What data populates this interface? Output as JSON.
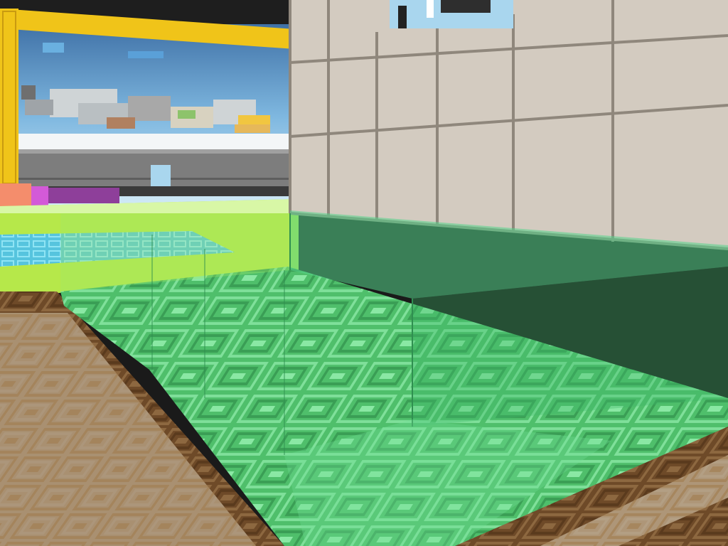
{
  "game": {
    "view": "first-person",
    "hud": "none",
    "colors": {
      "sky_top": "#3a6fa6",
      "sky_bottom": "#a9d6ee",
      "gold_frame": "#f0c419",
      "stone_wall": "#d3cbc0",
      "stone_grout": "#8f877c",
      "grass": "#b6e84a",
      "slime_glass": "#4ccb78",
      "floor_light": "#d8c8ac",
      "floor_dark": "#7a5632",
      "water_tiles": "#59c8e0",
      "gray_wall": "#7e7e7e"
    }
  }
}
